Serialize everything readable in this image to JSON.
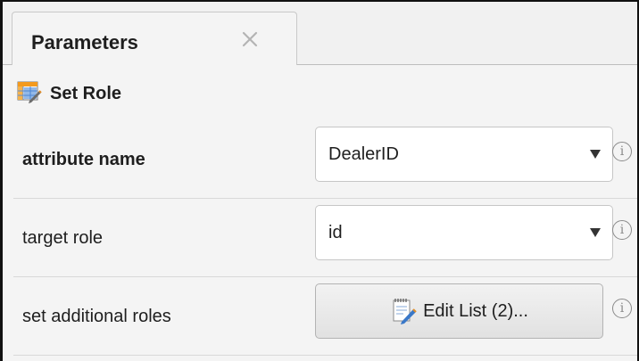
{
  "panel": {
    "tab_label": "Parameters",
    "close_glyph": "×",
    "operator_name": "Set Role",
    "operator_icon": "table-edit-icon"
  },
  "params": [
    {
      "label": "attribute name",
      "control": "select",
      "value": "DealerID"
    },
    {
      "label": "target role",
      "control": "select",
      "value": "id"
    },
    {
      "label": "set additional roles",
      "control": "button",
      "button_label": "Edit List (2)...",
      "button_icon": "edit-list-icon"
    }
  ],
  "info_glyph": "i",
  "colors": {
    "panel_bg": "#f4f4f4",
    "field_border": "#c6c6c6",
    "info": "#8a8a8a"
  }
}
